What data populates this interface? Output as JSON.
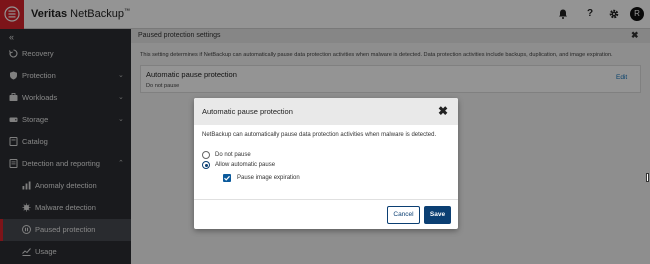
{
  "app": {
    "brand_bold": "Veritas",
    "brand_regular": "NetBackup",
    "brand_mark": "™",
    "user_initial": "R",
    "accent_color": "#d7242c",
    "primary_color": "#0b3f73"
  },
  "topbar": {
    "icons": [
      "bell-icon",
      "help-icon",
      "gear-icon"
    ],
    "help_glyph": "?"
  },
  "sidebar": {
    "collapse_glyph": "«",
    "items": [
      {
        "label": "Recovery",
        "icon": "recovery-icon"
      },
      {
        "label": "Protection",
        "icon": "shield-icon",
        "chevron": "⌄"
      },
      {
        "label": "Workloads",
        "icon": "workloads-icon",
        "chevron": "⌄"
      },
      {
        "label": "Storage",
        "icon": "storage-icon",
        "chevron": "⌄"
      },
      {
        "label": "Catalog",
        "icon": "catalog-icon"
      },
      {
        "label": "Detection and reporting",
        "icon": "report-icon",
        "chevron": "⌃"
      },
      {
        "label": "Anomaly detection",
        "icon": "chart-icon"
      },
      {
        "label": "Malware detection",
        "icon": "malware-icon"
      },
      {
        "label": "Paused protection",
        "icon": "pause-icon",
        "active": true
      },
      {
        "label": "Usage",
        "icon": "usage-icon"
      }
    ]
  },
  "main": {
    "title": "Paused protection settings",
    "close_glyph": "✖",
    "description": "This setting determines if NetBackup can automatically pause data protection activities when malware is detected. Data protection activities include backups, duplication, and image expiration.",
    "card": {
      "title": "Automatic pause protection",
      "value": "Do not pause",
      "edit_label": "Edit"
    }
  },
  "modal": {
    "title": "Automatic pause protection",
    "close_glyph": "✖",
    "description": "NetBackup can automatically pause data protection activities when malware is detected.",
    "options": [
      {
        "label": "Do not pause",
        "selected": false
      },
      {
        "label": "Allow automatic pause",
        "selected": true
      }
    ],
    "checkbox_label": "Pause image expiration",
    "checkbox_checked": true,
    "cancel_label": "Cancel",
    "save_label": "Save"
  }
}
